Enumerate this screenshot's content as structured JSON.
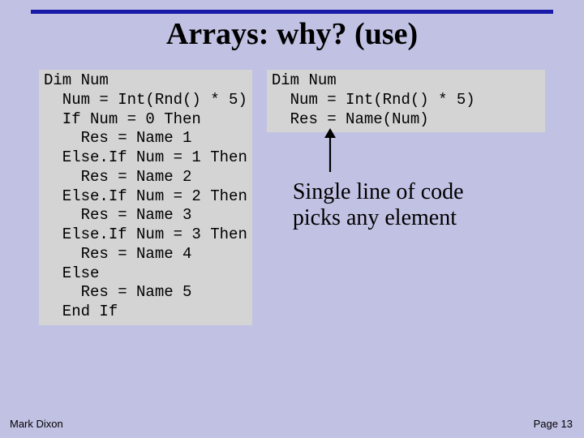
{
  "title": "Arrays: why? (use)",
  "code_left": "Dim Num\n  Num = Int(Rnd() * 5)\n  If Num = 0 Then\n    Res = Name 1\n  Else.If Num = 1 Then\n    Res = Name 2\n  Else.If Num = 2 Then\n    Res = Name 3\n  Else.If Num = 3 Then\n    Res = Name 4\n  Else\n    Res = Name 5\n  End If",
  "code_right": "Dim Num\n  Num = Int(Rnd() * 5)\n  Res = Name(Num)",
  "caption_line1": "Single line of code",
  "caption_line2": "picks any element",
  "footer": {
    "author": "Mark Dixon",
    "page": "Page 13"
  }
}
